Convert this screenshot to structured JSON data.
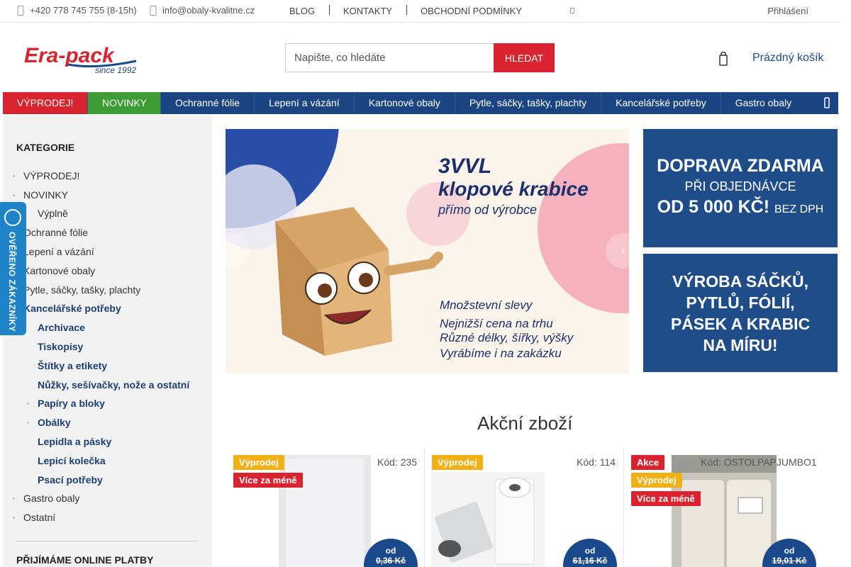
{
  "topbar": {
    "phone": "+420 778 745 755 (8-15h)",
    "email": "info@obaly-kvalitne.cz",
    "links": [
      "BLOG",
      "KONTAKTY",
      "OBCHODNÍ PODMÍNKY"
    ],
    "login": "Přihlášení"
  },
  "header": {
    "logo_text": "Era-pack",
    "logo_tagline": "since 1992",
    "search_placeholder": "Napište, co hledáte",
    "search_button": "HLEDAT",
    "cart_label": "Prázdný košík"
  },
  "nav": {
    "items": [
      "VÝPRODEJ!",
      "NOVINKY",
      "Ochranné fólie",
      "Lepení a vázání",
      "Kartonové obaly",
      "Pytle, sáčky, tašky, plachty",
      "Kancelářské potřeby",
      "Gastro obaly"
    ]
  },
  "sidebar": {
    "heading": "KATEGORIE",
    "categories": [
      "VÝPRODEJ!",
      "NOVINKY",
      "Výplně",
      "Ochranné fólie",
      "Lepení a vázání",
      "Kartonové obaly",
      "Pytle, sáčky, tašky, plachty",
      "Kancelářské potřeby",
      "Archivace",
      "Tiskopisy",
      "Štítky a etikety",
      "Nůžky, sešívačky, nože a ostatní",
      "Papíry a bloky",
      "Obálky",
      "Lepidla a pásky",
      "Lepicí kolečka",
      "Psací potřeby",
      "Gastro obaly",
      "Ostatní"
    ],
    "payments_heading": "PŘIJÍMÁME ONLINE PLATBY"
  },
  "verified_badge": "OVĚŘENO ZÁKAZNÍKY",
  "slider": {
    "title_line1": "3VVL",
    "title_line2": "klopové krabice",
    "subtitle": "přímo od výrobce",
    "bullets": [
      "Množstevní slevy",
      "Nejnižší cena na trhu",
      "Různé délky, šířky, výšky",
      "Vyrábíme i na zakázku"
    ]
  },
  "promos": [
    {
      "line1": "DOPRAVA ZDARMA",
      "line2": "PŘI OBJEDNÁVCE",
      "line3": "OD 5 000 KČ!",
      "line3b": "BEZ DPH"
    },
    {
      "line1": "VÝROBA SÁČKŮ,",
      "line2": "PYTLŮ, FÓLIÍ,",
      "line3": "PÁSEK A KRABIC",
      "line4": "NA MÍRU!"
    }
  ],
  "section_title": "Akční zboží",
  "products": [
    {
      "badges": [
        "Výprodej",
        "Více za méně"
      ],
      "code": "Kód: 235",
      "price_prefix": "od",
      "price": "0,36 Kč"
    },
    {
      "badges": [
        "Výprodej"
      ],
      "code": "Kód: 114",
      "price_prefix": "od",
      "price": "61,16 Kč"
    },
    {
      "badges": [
        "Akce",
        "Výprodej",
        "Více za méně"
      ],
      "code": "Kód: OSTOLPAPJUMBO1",
      "price_prefix": "od",
      "price": "19,01 Kč"
    }
  ],
  "colors": {
    "brand_blue": "#1b4482",
    "accent_red": "#d9232e",
    "new_green": "#3d9c34",
    "badge_yellow": "#f2b017",
    "verified_blue": "#1e83c7"
  }
}
